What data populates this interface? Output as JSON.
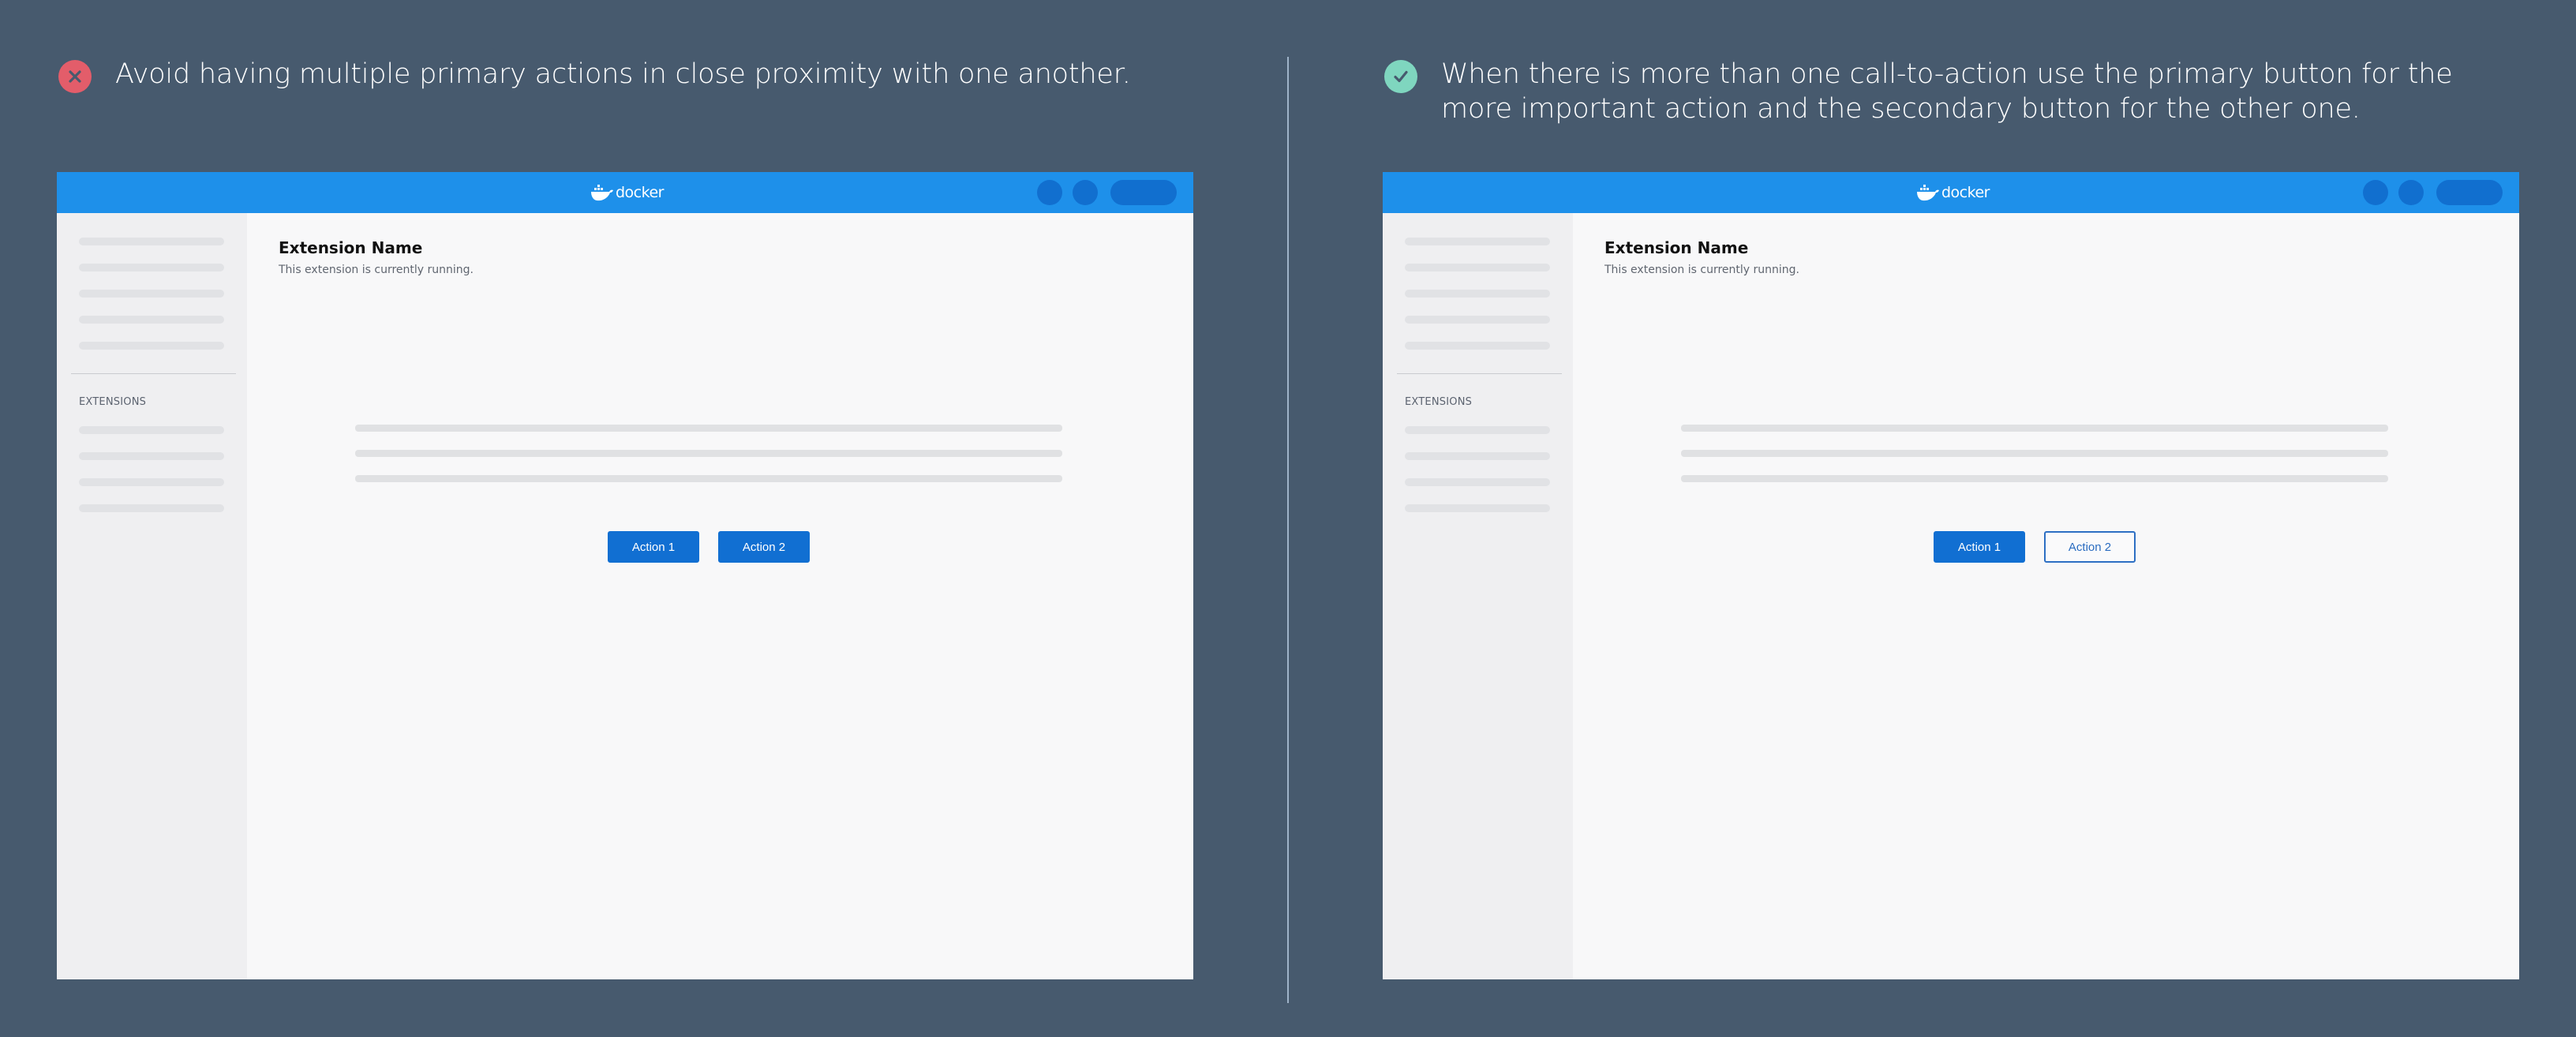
{
  "colors": {
    "background": "#475a6e",
    "dont_icon": "#e35d6a",
    "do_icon": "#7fd6bf",
    "topbar": "#1e90ea",
    "primary_button": "#116fd2"
  },
  "examples": [
    {
      "kind": "dont",
      "icon": "x-circle-icon",
      "guideline": "Avoid having multiple primary actions in close proximity with one another.",
      "app": {
        "logo_text": "docker",
        "sidebar_section": "EXTENSIONS",
        "title": "Extension Name",
        "subtitle": "This extension is currently running.",
        "buttons": [
          {
            "label": "Action 1",
            "variant": "primary"
          },
          {
            "label": "Action 2",
            "variant": "primary"
          }
        ]
      }
    },
    {
      "kind": "do",
      "icon": "check-circle-icon",
      "guideline": "When there is more than one call-to-action use the primary button for the more important action and the secondary button for the other one.",
      "app": {
        "logo_text": "docker",
        "sidebar_section": "EXTENSIONS",
        "title": "Extension Name",
        "subtitle": "This extension is currently running.",
        "buttons": [
          {
            "label": "Action 1",
            "variant": "primary"
          },
          {
            "label": "Action 2",
            "variant": "secondary"
          }
        ]
      }
    }
  ]
}
